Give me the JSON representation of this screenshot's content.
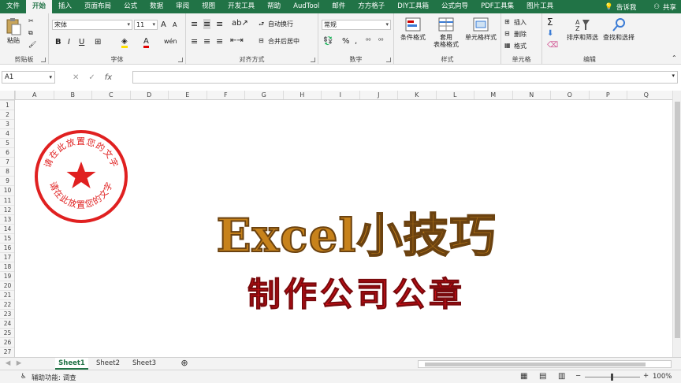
{
  "menu": {
    "items": [
      "文件",
      "开始",
      "插入",
      "页面布局",
      "公式",
      "数据",
      "审阅",
      "视图",
      "开发工具",
      "帮助",
      "AudTool",
      "邮件",
      "方方格子",
      "DIY工具箱",
      "公式向导",
      "PDF工具集",
      "图片工具"
    ],
    "tell_me": "告诉我",
    "share": "共享"
  },
  "ribbon": {
    "clipboard": {
      "paste": "粘贴",
      "label": "剪贴板"
    },
    "font": {
      "name": "宋体",
      "size": "11",
      "bold": "B",
      "italic": "I",
      "underline": "U",
      "grow": "A",
      "shrink": "A",
      "color_letter": "A",
      "wen": "wén",
      "label": "字体"
    },
    "align": {
      "wrap": "自动换行",
      "merge": "合并后居中",
      "label": "对齐方式"
    },
    "number": {
      "format": "常规",
      "percent": "%",
      "comma": ",",
      "label": "数字"
    },
    "styles": {
      "conditional": "条件格式",
      "table1": "套用",
      "table2": "表格格式",
      "cell_style": "单元格样式",
      "label": "样式"
    },
    "cells": {
      "insert": "插入",
      "delete": "删除",
      "format": "格式",
      "label": "单元格"
    },
    "editing": {
      "sort": "排序和筛选",
      "find": "查找和选择",
      "label": "编辑"
    }
  },
  "formula_bar": {
    "name_box": "A1",
    "fx": "fx",
    "value": ""
  },
  "columns": [
    "A",
    "B",
    "C",
    "D",
    "E",
    "F",
    "G",
    "H",
    "I",
    "J",
    "K",
    "L",
    "M",
    "N",
    "O",
    "P",
    "Q"
  ],
  "rows": [
    "1",
    "2",
    "3",
    "4",
    "5",
    "6",
    "7",
    "8",
    "9",
    "10",
    "11",
    "12",
    "13",
    "14",
    "15",
    "16",
    "17",
    "18",
    "19",
    "20",
    "21",
    "22",
    "23",
    "24",
    "25",
    "26",
    "27"
  ],
  "seal": {
    "top_text": "请在此放置您的文字",
    "bottom_text": "请在此放置您的文字",
    "color": "#e02020"
  },
  "content": {
    "title": "Excel小技巧",
    "subtitle": "制作公司公章",
    "title_color": "#c7821b",
    "subtitle_color": "#d80f17"
  },
  "sheets": {
    "tabs": [
      "Sheet1",
      "Sheet2",
      "Sheet3"
    ],
    "active": "Sheet1",
    "add": "⊕"
  },
  "status": {
    "accessibility": "辅助功能: 调查",
    "zoom": "100%",
    "zoom_minus": "−",
    "zoom_plus": "+"
  },
  "accent": "#217346"
}
